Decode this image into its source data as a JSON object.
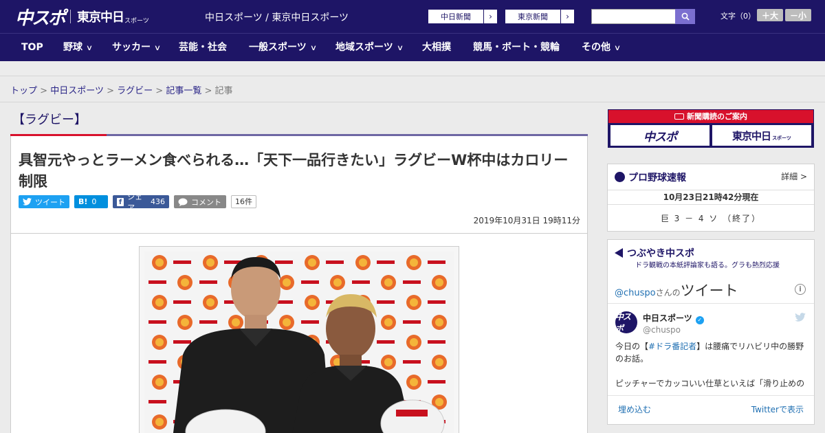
{
  "header": {
    "logo_chuspo": "中スポ",
    "logo_tokyo": "東京中日",
    "logo_sports": "スポーツ",
    "site_title": "中日スポーツ / 東京中日スポーツ",
    "paper_links": [
      "中日新聞",
      "東京新聞"
    ],
    "font_size_label": "文字（0）",
    "font_larger": "＋大",
    "font_smaller": "－小"
  },
  "nav": [
    {
      "label": "TOP",
      "dropdown": false
    },
    {
      "label": "野球",
      "dropdown": true
    },
    {
      "label": "サッカー",
      "dropdown": true
    },
    {
      "label": "芸能・社会",
      "dropdown": false
    },
    {
      "label": "一般スポーツ",
      "dropdown": true
    },
    {
      "label": "地域スポーツ",
      "dropdown": true
    },
    {
      "label": "大相撲",
      "dropdown": false
    },
    {
      "label": "競馬・ボート・競輪",
      "dropdown": false
    },
    {
      "label": "その他",
      "dropdown": true
    }
  ],
  "breadcrumb": {
    "items": [
      "トップ",
      "中日スポーツ",
      "ラグビー",
      "記事一覧"
    ],
    "current": "記事",
    "separator": ">"
  },
  "article": {
    "category": "【ラグビー】",
    "headline": "具智元やっとラーメン食べられる…「天下一品行きたい」ラグビーW杯中はカロリー制限",
    "share": {
      "tweet_label": "ツイート",
      "hatena_label": "B!",
      "hatena_count": "0",
      "facebook_label": "シェア",
      "facebook_count": "436",
      "comment_label": "コメント",
      "comment_count": "16件"
    },
    "published": "2019年10月31日 19時11分"
  },
  "sidebar": {
    "subscribe": {
      "title": "新聞購読のご案内",
      "chuspo": "中スポ",
      "tokyo": "東京中日",
      "tokyo_small": "スポーツ"
    },
    "baseball": {
      "title": "プロ野球速報",
      "details": "詳細 >",
      "datetime": "10月23日21時42分現在",
      "score": "巨 3 － 4 ソ （終了）"
    },
    "tweets": {
      "title": "つぶやき中スポ",
      "subtitle": "ドラ観戦の本紙評論家も語る。グラも熱烈応援",
      "handle": "@chuspo",
      "handle_suffix": "さんの",
      "handle_tweet": "ツイート",
      "account_name": "中日スポーツ",
      "account_user": "@chuspo",
      "avatar_text": "中スポ",
      "body_prefix": "今日の【",
      "body_tag": "#ドラ番記者",
      "body_suffix": "】は腰痛でリハビリ中の勝野のお話。",
      "body_second": "ピッチャーでカッコいい仕草といえば「滑り止めの",
      "embed": "埋め込む",
      "view_on_twitter": "Twitterで表示"
    }
  },
  "colors": {
    "navy": "#1e1566",
    "red_accent": "#d8112c",
    "twitter_blue": "#1da1f2",
    "facebook_blue": "#3b5998",
    "hatena_blue": "#008fde"
  }
}
